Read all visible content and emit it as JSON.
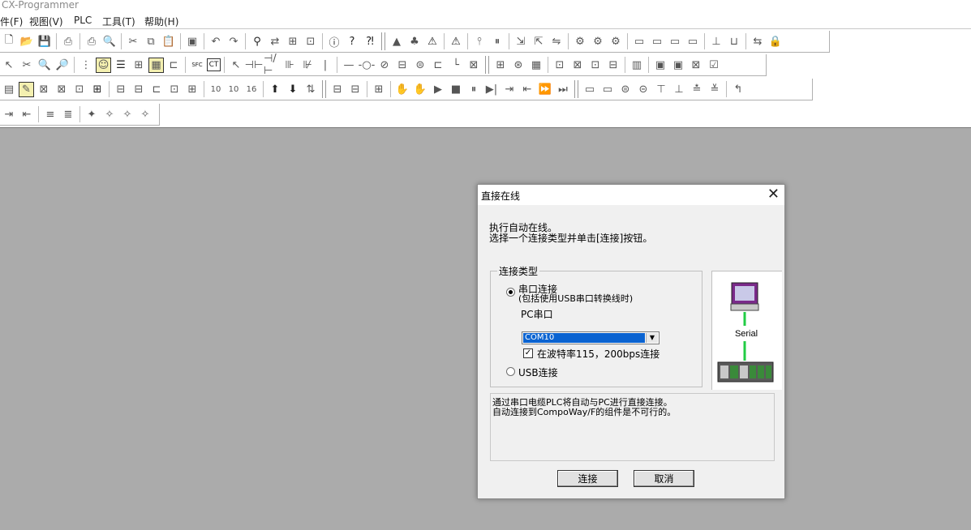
{
  "app": {
    "title": "CX-Programmer"
  },
  "menu": [
    {
      "id": "file",
      "label": "件(F)"
    },
    {
      "id": "view",
      "label": "视图(V)"
    },
    {
      "id": "plc",
      "label": "PLC"
    },
    {
      "id": "tools",
      "label": "工具(T)"
    },
    {
      "id": "help",
      "label": "帮助(H)"
    }
  ],
  "toolbar_glyphs": {
    "numbers": [
      "10",
      "10",
      "16"
    ],
    "sfc": "SFC",
    "ct": "CT"
  },
  "dialog": {
    "title": "直接在线",
    "close_glyph": "✕",
    "intro_line1": "执行自动在线。",
    "intro_line2": "选择一个连接类型并单击[连接]按钮。",
    "group_label": "连接类型",
    "serial_option": "串口连接",
    "serial_note": "(包括使用USB串口转换线时)",
    "pc_port_label": "PC串口",
    "port_selected": "COM10",
    "baud_checkbox_label": "在波特率115，200bps连接",
    "baud_checked": true,
    "usb_option": "USB连接",
    "selected_connection": "serial",
    "diagram_label": "Serial",
    "description_line1": "通过串口电缆PLC将自动与PC进行直接连接。",
    "description_line2": "自动连接到CompoWay/F的组件是不可行的。",
    "connect_button": "连接",
    "cancel_button": "取消"
  },
  "colors": {
    "workspace": "#ababab",
    "selection": "#0a63d1",
    "cable": "#22cc44"
  }
}
